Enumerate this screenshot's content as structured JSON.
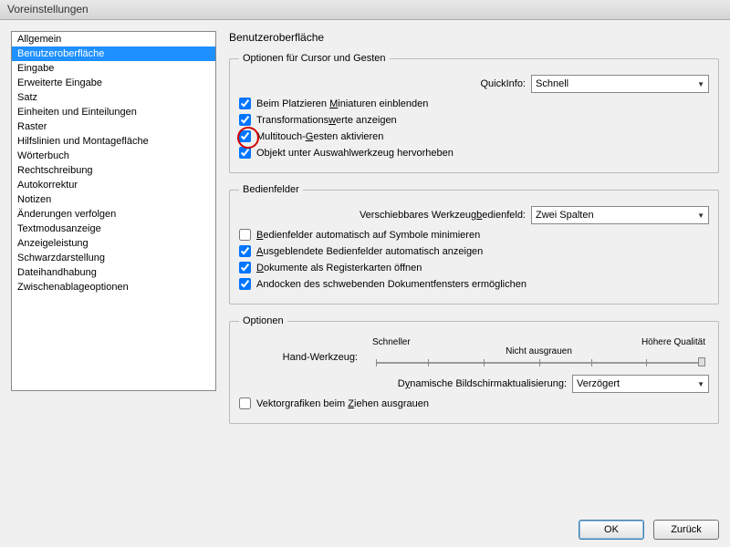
{
  "window": {
    "title": "Voreinstellungen"
  },
  "sidebar": {
    "items": [
      "Allgemein",
      "Benutzeroberfläche",
      "Eingabe",
      "Erweiterte Eingabe",
      "Satz",
      "Einheiten und Einteilungen",
      "Raster",
      "Hilfslinien und Montagefläche",
      "Wörterbuch",
      "Rechtschreibung",
      "Autokorrektur",
      "Notizen",
      "Änderungen verfolgen",
      "Textmodusanzeige",
      "Anzeigeleistung",
      "Schwarzdarstellung",
      "Dateihandhabung",
      "Zwischenablageoptionen"
    ],
    "selected_index": 1
  },
  "main": {
    "heading": "Benutzeroberfläche",
    "group1": {
      "legend": "Optionen für Cursor und Gesten",
      "quickinfo_label": "QuickInfo:",
      "quickinfo_value": "Schnell",
      "cb_thumbnails": "Beim Platzieren Miniaturen einblenden",
      "cb_transform": "Transformationswerte anzeigen",
      "cb_multitouch": "Multitouch-Gesten aktivieren",
      "cb_highlight": "Objekt unter Auswahlwerkzeug hervorheben"
    },
    "group2": {
      "legend": "Bedienfelder",
      "toolpanel_label": "Verschiebbares Werkzeugbedienfeld:",
      "toolpanel_value": "Zwei Spalten",
      "cb_minimize": "Bedienfelder automatisch auf Symbole minimieren",
      "cb_show_hidden": "Ausgeblendete Bedienfelder automatisch anzeigen",
      "cb_tabs": "Dokumente als Registerkarten öffnen",
      "cb_dock": "Andocken des schwebenden Dokumentfensters ermöglichen"
    },
    "group3": {
      "legend": "Optionen",
      "slider_left": "Schneller",
      "slider_right": "Höhere Qualität",
      "hand_label": "Hand-Werkzeug:",
      "slider_caption": "Nicht ausgrauen",
      "dyn_label": "Dynamische Bildschirmaktualisierung:",
      "dyn_value": "Verzögert",
      "cb_vector": "Vektorgrafiken beim Ziehen ausgrauen"
    }
  },
  "buttons": {
    "ok": "OK",
    "back": "Zurück"
  }
}
